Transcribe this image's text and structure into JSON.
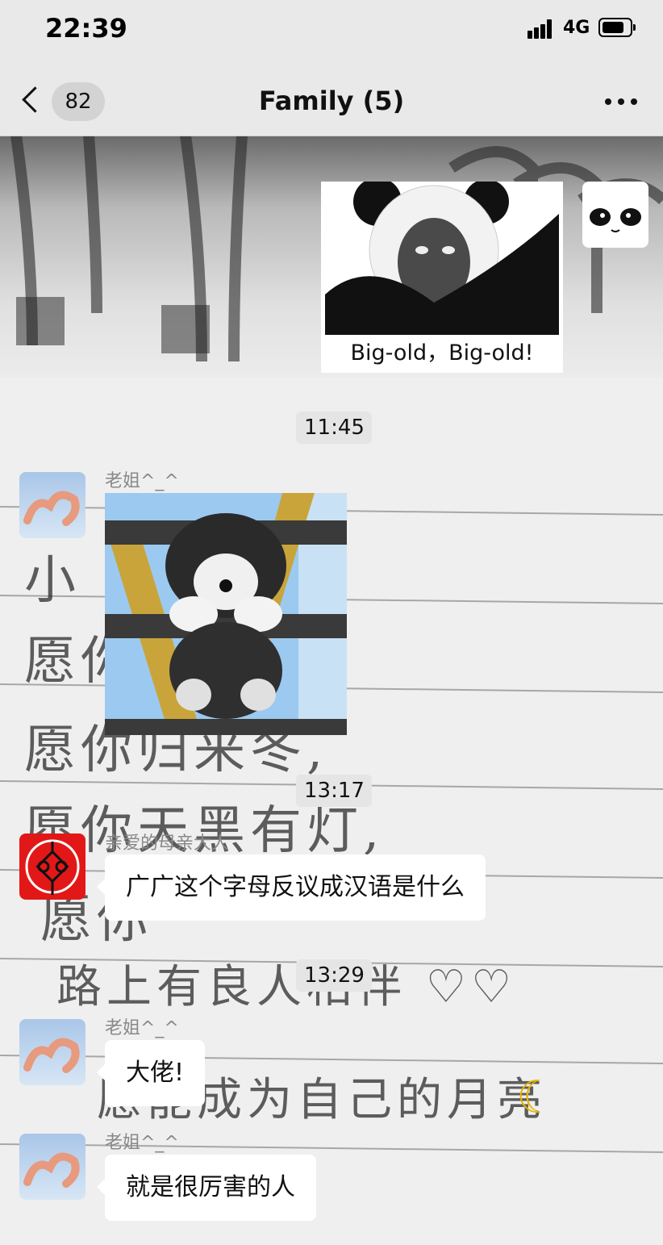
{
  "status_bar": {
    "time": "22:39",
    "network": "4G",
    "battery_level": 0.8
  },
  "nav": {
    "unread_count": "82",
    "title": "Family (5)"
  },
  "messages": {
    "sticker_caption": "Big-old，Big-old!",
    "time_1": "11:45",
    "sender_1": "老姐^_^",
    "time_2": "13:17",
    "sender_2": "亲爱的母亲大人",
    "text_2": "广广这个字母反议成汉语是什么",
    "time_3": "13:29",
    "sender_3": "老姐^_^",
    "text_3": "大佬!",
    "sender_4": "老姐^_^",
    "text_4": "就是很厉害的人"
  },
  "wallpaper": {
    "lines": [
      "小",
      "愿你",
      "愿你归来冬,",
      "愿你天黑有灯,",
      "愿你",
      "路上有良人相伴 ♡♡",
      "愿能成为自己的月亮"
    ]
  },
  "colors": {
    "bubble": "#ffffff",
    "header": "#e9e9e9",
    "name": "#888888"
  },
  "icons": [
    "back-arrow-icon",
    "more-icon",
    "signal-icon",
    "battery-icon",
    "panda-avatar-icon",
    "heart-hands-avatar-icon",
    "chinese-knot-avatar-icon",
    "moon-icon"
  ]
}
